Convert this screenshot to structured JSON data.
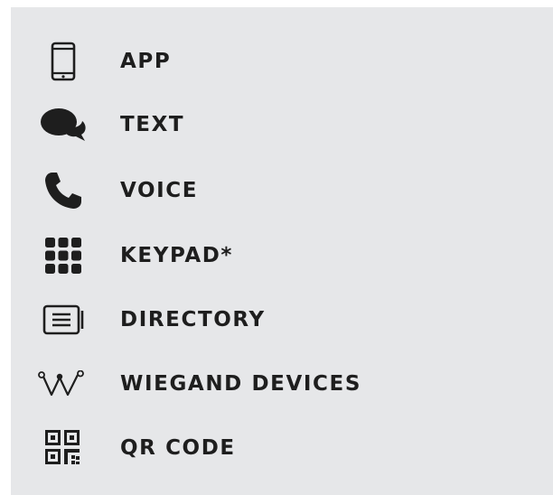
{
  "colors": {
    "panel_background": "#e6e7e9",
    "icon": "#1e1e1e",
    "text": "#1e1e1e"
  },
  "items": [
    {
      "label": "APP",
      "icon": "smartphone-icon"
    },
    {
      "label": "TEXT",
      "icon": "chat-bubbles-icon"
    },
    {
      "label": "VOICE",
      "icon": "phone-icon"
    },
    {
      "label": "KEYPAD*",
      "icon": "keypad-icon"
    },
    {
      "label": "DIRECTORY",
      "icon": "directory-list-icon"
    },
    {
      "label": "WIEGAND DEVICES",
      "icon": "wiegand-icon"
    },
    {
      "label": "QR CODE",
      "icon": "qr-code-icon"
    }
  ]
}
